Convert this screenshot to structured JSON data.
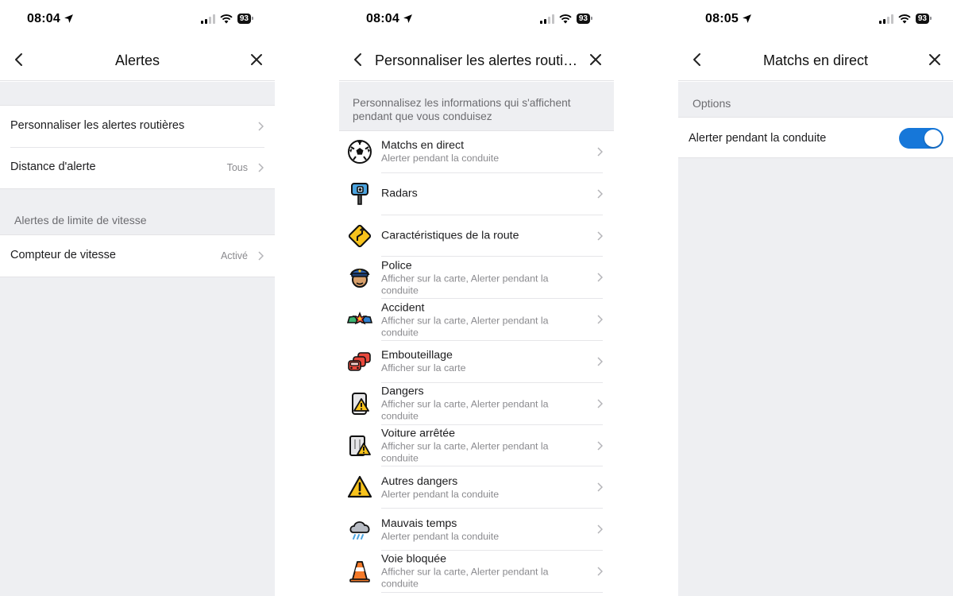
{
  "screen1": {
    "status": {
      "time": "08:04",
      "battery": "93"
    },
    "title": "Alertes",
    "rows": [
      {
        "label": "Personnaliser les alertes routières",
        "value": ""
      },
      {
        "label": "Distance d'alerte",
        "value": "Tous"
      }
    ],
    "section_label": "Alertes de limite de vitesse",
    "speed_row": {
      "label": "Compteur de vitesse",
      "value": "Activé"
    }
  },
  "screen2": {
    "status": {
      "time": "08:04",
      "battery": "93"
    },
    "title": "Personnaliser les alertes routiè...",
    "intro": "Personnalisez les informations qui s'affichent pendant que vous conduisez",
    "items": [
      {
        "name": "Matchs en direct",
        "sub": "Alerter pendant la conduite",
        "icon": "soccer-ball-icon"
      },
      {
        "name": "Radars",
        "sub": "",
        "icon": "speed-camera-icon"
      },
      {
        "name": "Caractéristiques de la route",
        "sub": "",
        "icon": "road-sign-icon"
      },
      {
        "name": "Police",
        "sub": "Afficher sur la carte, Alerter pendant la conduite",
        "icon": "police-officer-icon"
      },
      {
        "name": "Accident",
        "sub": "Afficher sur la carte, Alerter pendant la conduite",
        "icon": "car-crash-icon"
      },
      {
        "name": "Embouteillage",
        "sub": "Afficher sur la carte",
        "icon": "traffic-jam-icon"
      },
      {
        "name": "Dangers",
        "sub": "Afficher sur la carte, Alerter pendant la conduite",
        "icon": "hazard-phone-icon"
      },
      {
        "name": "Voiture arrêtée",
        "sub": "Afficher sur la carte, Alerter pendant la conduite",
        "icon": "stopped-car-icon"
      },
      {
        "name": "Autres dangers",
        "sub": "Alerter pendant la conduite",
        "icon": "warning-triangle-icon"
      },
      {
        "name": "Mauvais temps",
        "sub": "Alerter pendant la conduite",
        "icon": "storm-cloud-icon"
      },
      {
        "name": "Voie bloquée",
        "sub": "Afficher sur la carte, Alerter pendant la conduite",
        "icon": "traffic-cone-icon"
      }
    ]
  },
  "screen3": {
    "status": {
      "time": "08:05",
      "battery": "93"
    },
    "title": "Matchs en direct",
    "options_label": "Options",
    "toggle_row": {
      "label": "Alerter pendant la conduite",
      "state": "on"
    }
  },
  "colors": {
    "toggle_on": "#1677d9",
    "grey_background": "#eeeff2"
  }
}
